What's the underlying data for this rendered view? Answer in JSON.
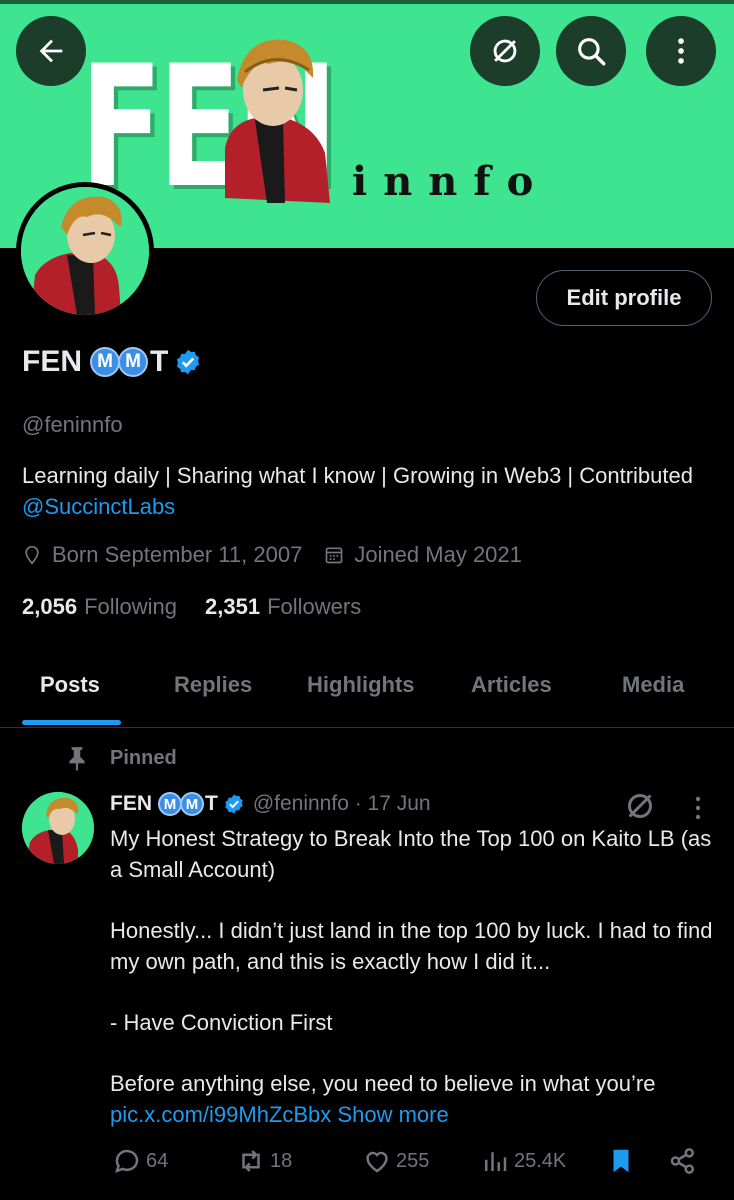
{
  "banner": {
    "big_text": "FEN",
    "small_text": "innfo"
  },
  "profile": {
    "name": "FEN",
    "name_badges": [
      "M",
      "M"
    ],
    "name_suffix": "T",
    "handle": "@feninnfo",
    "bio_text": "Learning daily | Sharing what I know | Growing in Web3 | Contributed ",
    "bio_link": "@SuccinctLabs",
    "location_label": "Born September 11, 2007",
    "joined_label": "Joined May 2021",
    "following_count": "2,056",
    "following_label": "Following",
    "followers_count": "2,351",
    "followers_label": "Followers",
    "edit_button": "Edit profile"
  },
  "tabs": [
    {
      "label": "Posts",
      "active": true
    },
    {
      "label": "Replies",
      "active": false
    },
    {
      "label": "Highlights",
      "active": false
    },
    {
      "label": "Articles",
      "active": false
    },
    {
      "label": "Media",
      "active": false
    }
  ],
  "post": {
    "pinned_label": "Pinned",
    "author_name": "FEN",
    "author_badges": [
      "M",
      "M"
    ],
    "author_suffix": "T",
    "author_handle_date": "@feninnfo · 17 Jun",
    "lines": {
      "l1": "My Honest Strategy to Break Into the Top 100 on Kaito LB (as a Small Account)",
      "l2": "Honestly... I didn’t just land in the top 100 by luck. I had to find my own path, and this is exactly how I did it...",
      "l3": "- Have Conviction First",
      "l4": "Before anything else, you need to believe in what you’re"
    },
    "link": "pic.x.com/i99MhZcBbx",
    "show_more": "Show more",
    "replies": "64",
    "reposts": "18",
    "likes": "255",
    "views": "25.4K"
  },
  "colors": {
    "accent": "#1d9bf0",
    "banner_green": "#3ee48f",
    "muted": "#71767b",
    "verified": "#1d9bf0"
  },
  "icons": [
    "back-arrow-icon",
    "grok-icon",
    "search-icon",
    "more-vertical-icon",
    "verified-icon",
    "location-icon",
    "calendar-icon",
    "pin-icon",
    "reply-icon",
    "repost-icon",
    "like-icon",
    "views-icon",
    "bookmark-icon",
    "share-icon"
  ]
}
